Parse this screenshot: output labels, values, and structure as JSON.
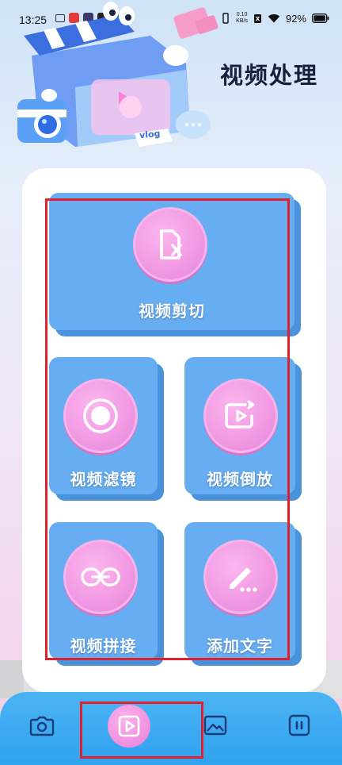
{
  "status_bar": {
    "time": "13:25",
    "net_speed_value": "0.10",
    "net_speed_unit": "KB/s",
    "battery": "92%"
  },
  "hero": {
    "title": "视频处理",
    "sticker_text": "vlog"
  },
  "tools": [
    {
      "label": "视频剪切",
      "icon": "video-cut-icon"
    },
    {
      "label": "视频滤镜",
      "icon": "filter-circle-icon"
    },
    {
      "label": "视频倒放",
      "icon": "reverse-play-icon"
    },
    {
      "label": "视频拼接",
      "icon": "link-icon"
    },
    {
      "label": "添加文字",
      "icon": "pencil-text-icon"
    }
  ],
  "bottom_nav": [
    {
      "name": "camera",
      "icon": "camera-icon",
      "active": false
    },
    {
      "name": "video",
      "icon": "play-square-icon",
      "active": true
    },
    {
      "name": "image",
      "icon": "image-icon",
      "active": false
    },
    {
      "name": "profile",
      "icon": "profile-icon",
      "active": false
    }
  ],
  "colors": {
    "tile": "#67adf1",
    "tile_shadow": "#4a93dc",
    "circle": "#f29be4",
    "nav": "#31a3ef",
    "highlight_box": "#e0202c",
    "title": "#16213d"
  }
}
